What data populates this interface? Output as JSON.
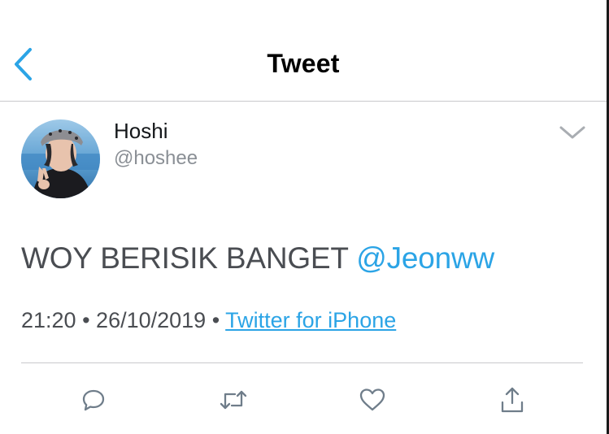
{
  "header": {
    "title": "Tweet",
    "back_icon": "chevron-left-icon",
    "accent_color": "#2ba4e6"
  },
  "tweet": {
    "author": {
      "display_name": "Hoshi",
      "handle": "@hoshee"
    },
    "text": "WOY BERISIK BANGET ",
    "mention": "@Jeonww",
    "time": "21:20",
    "separator": " • ",
    "date": "26/10/2019",
    "source": "Twitter for iPhone",
    "menu_icon": "chevron-down-icon"
  },
  "actions": [
    {
      "icon": "reply-icon"
    },
    {
      "icon": "retweet-icon"
    },
    {
      "icon": "like-icon"
    },
    {
      "icon": "share-icon"
    }
  ]
}
